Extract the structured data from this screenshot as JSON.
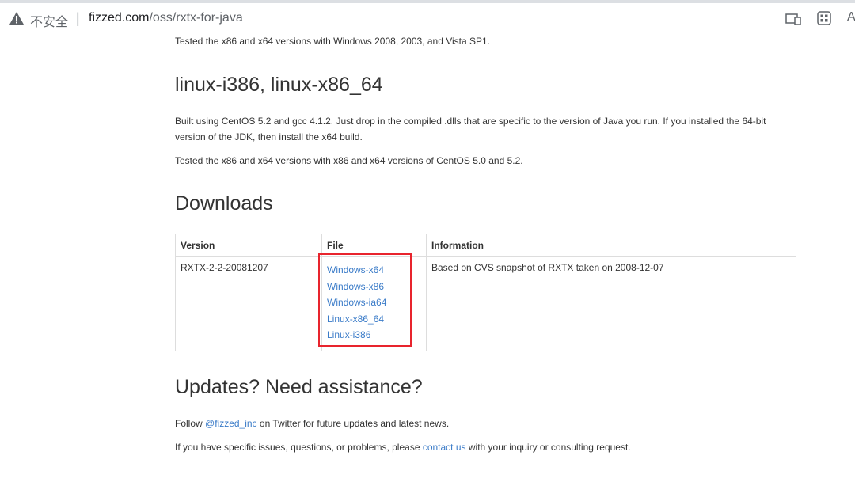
{
  "browser": {
    "security_label": "不安全",
    "separator": "|",
    "url_domain": "fizzed.com",
    "url_path": "/oss/rxtx-for-java",
    "read_aloud_glyph": "A",
    "icons": [
      "warning-icon",
      "tab-search-icon",
      "extensions-grid-icon",
      "read-aloud-icon"
    ]
  },
  "page": {
    "tested_windows": "Tested the x86 and x64 versions with Windows 2008, 2003, and Vista SP1.",
    "linux_heading": "linux-i386, linux-x86_64",
    "linux_built": "Built using CentOS 5.2 and gcc 4.1.2. Just drop in the compiled .dlls that are specific to the version of Java you run. If you installed the 64-bit version of the JDK, then install the x64 build.",
    "linux_tested": "Tested the x86 and x64 versions with x86 and x64 versions of CentOS 5.0 and 5.2.",
    "downloads_heading": "Downloads",
    "table": {
      "headers": [
        "Version",
        "File",
        "Information"
      ],
      "row": {
        "version": "RXTX-2-2-20081207",
        "files": [
          "Windows-x64",
          "Windows-x86",
          "Windows-ia64",
          "Linux-x86_64",
          "Linux-i386"
        ],
        "information": "Based on CVS snapshot of RXTX taken on 2008-12-07"
      }
    },
    "updates_heading": "Updates? Need assistance?",
    "follow": {
      "prefix": "Follow ",
      "link": "@fizzed_inc",
      "suffix": " on Twitter for future updates and latest news."
    },
    "issues": {
      "prefix": "If you have specific issues, questions, or problems, please ",
      "link": "contact us",
      "suffix": " with your inquiry or consulting request."
    }
  },
  "colors": {
    "link": "#3a7bc8",
    "highlight": "#e8242d",
    "text": "#333333"
  }
}
